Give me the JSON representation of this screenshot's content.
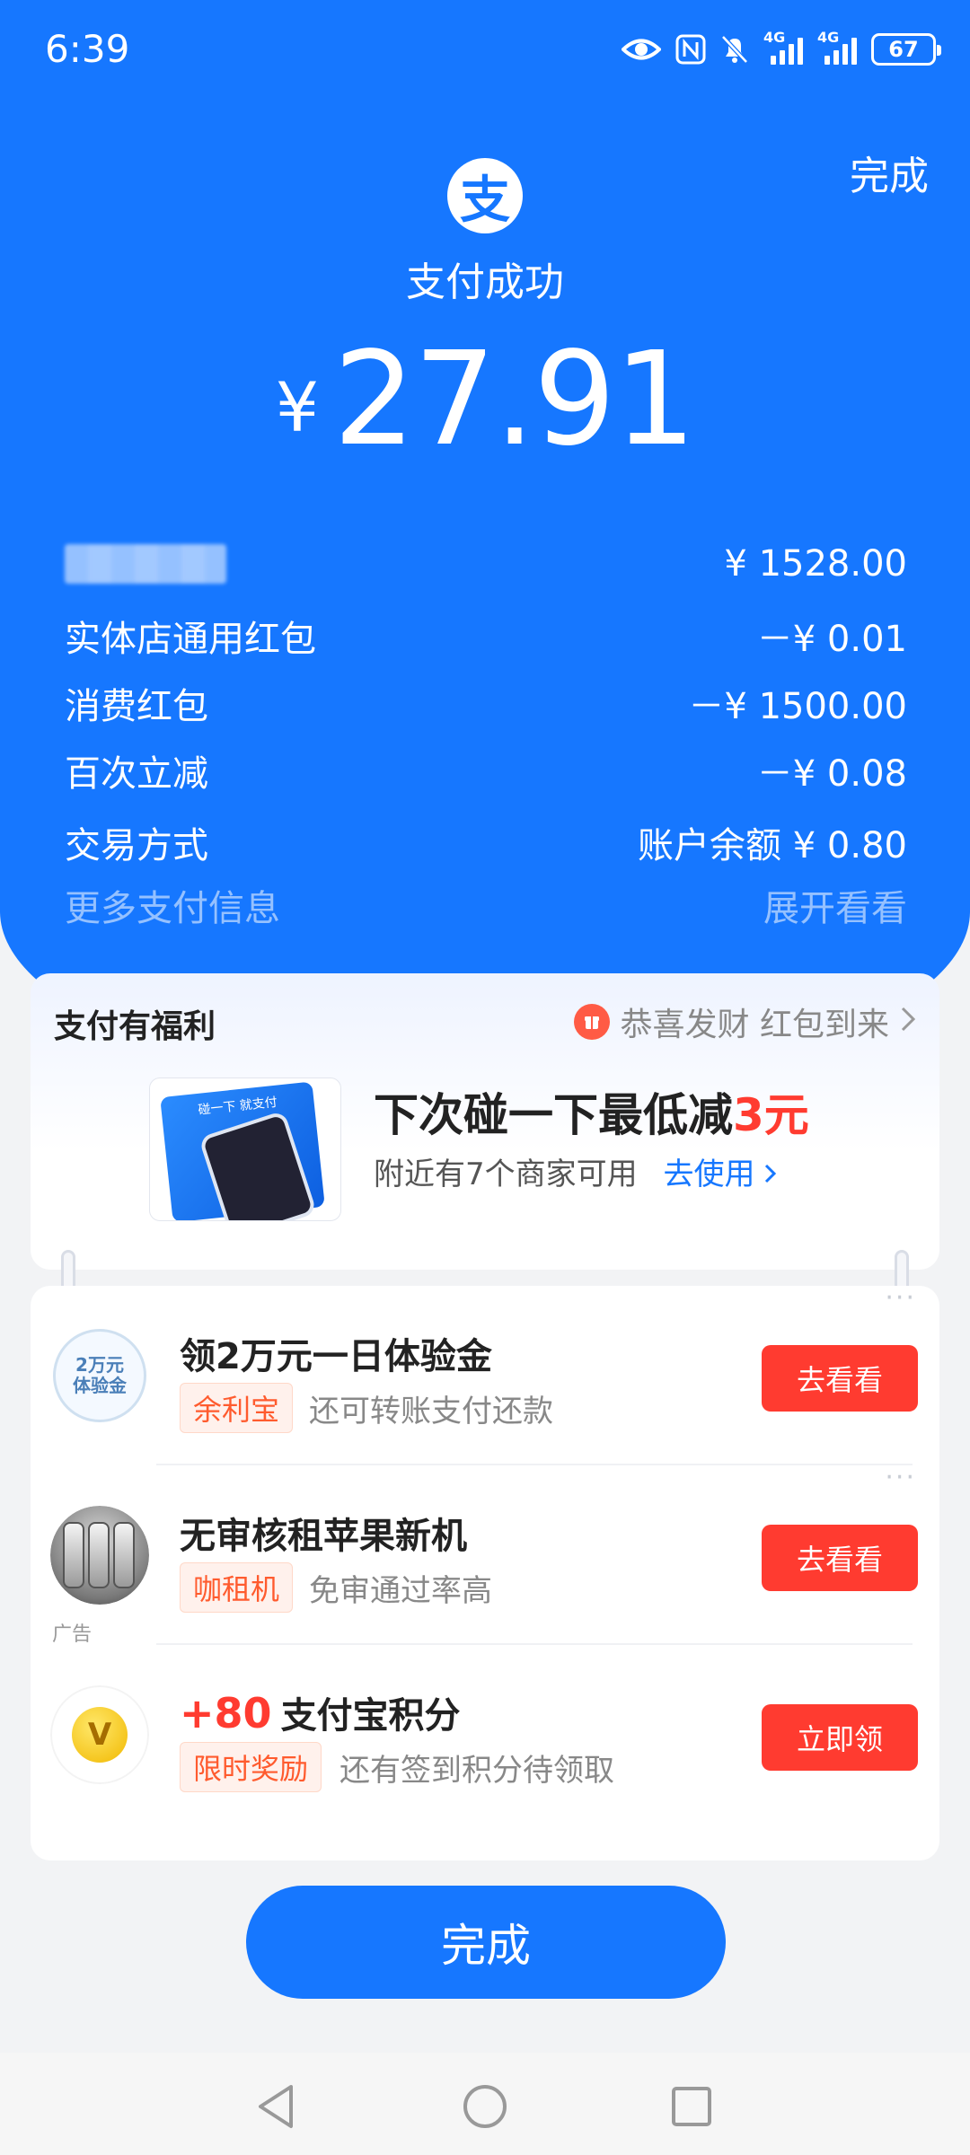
{
  "status_bar": {
    "time": "6:39",
    "signal_label": "4G",
    "battery": "67"
  },
  "header": {
    "done_label": "完成",
    "logo_char": "支",
    "title": "支付成功",
    "currency": "¥",
    "amount": "27.91"
  },
  "details": {
    "rows": [
      {
        "label": "",
        "value": "¥ 1528.00"
      },
      {
        "label": "实体店通用红包",
        "value": "－¥ 0.01"
      },
      {
        "label": "消费红包",
        "value": "－¥ 1500.00"
      },
      {
        "label": "百次立减",
        "value": "－¥ 0.08"
      },
      {
        "label": "交易方式",
        "value": "账户余额 ¥ 0.80"
      }
    ],
    "more_label": "更多支付信息",
    "expand_label": "展开看看"
  },
  "benefit": {
    "title": "支付有福利",
    "promo": "恭喜发财 红包到来",
    "image_text": "碰一下 就支付",
    "headline_prefix": "下次碰一下最低减",
    "headline_highlight": "3元",
    "subtext": "附近有7个商家可用",
    "use_label": "去使用"
  },
  "tasks": [
    {
      "icon": "experience-fund-icon",
      "icon_text_1": "2万元",
      "icon_text_2": "体验金",
      "title": "领2万元一日体验金",
      "tag": "余利宝",
      "desc": "还可转账支付还款",
      "button": "去看看"
    },
    {
      "icon": "iphone-product-icon",
      "title": "无审核租苹果新机",
      "tag": "咖租机",
      "desc": "免审通过率高",
      "button": "去看看",
      "ad": "广告"
    },
    {
      "icon": "points-coin-icon",
      "points": "+80",
      "title": "支付宝积分",
      "tag": "限时奖励",
      "desc": "还有签到积分待领取",
      "button": "立即领"
    }
  ],
  "footer": {
    "done_label": "完成"
  },
  "colors": {
    "brand_blue": "#1677ff",
    "accent_red": "#ff3b30"
  }
}
